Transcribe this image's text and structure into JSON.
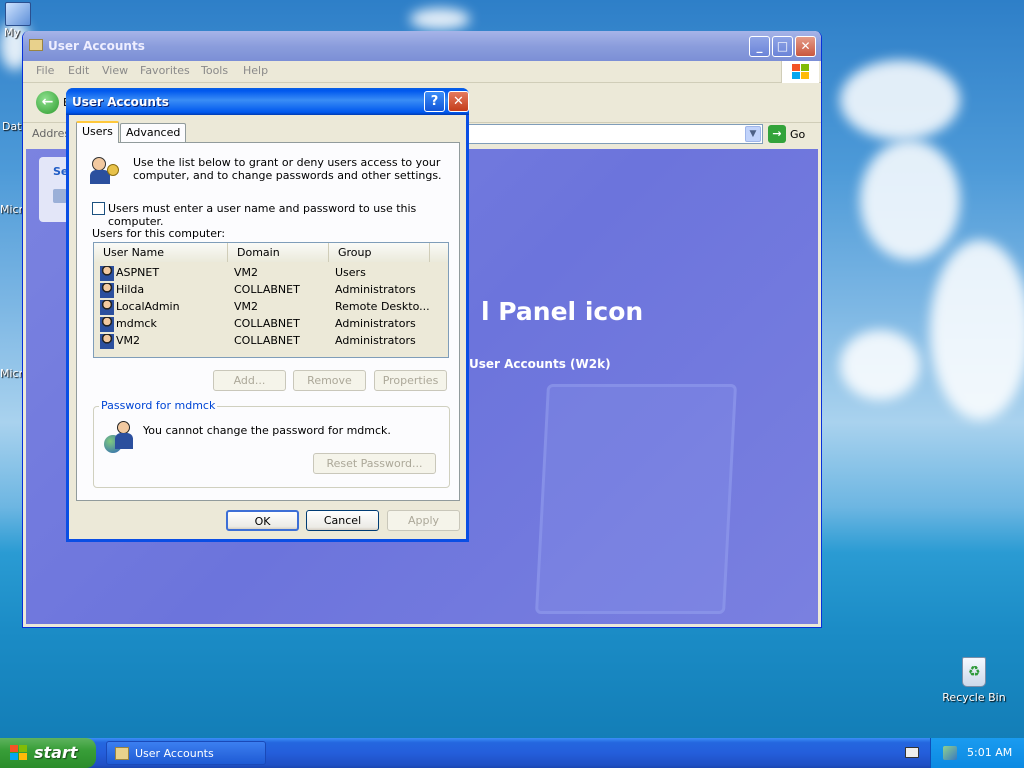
{
  "desktop": {
    "icons": [
      {
        "label": "My"
      },
      {
        "label": "Dat"
      },
      {
        "label": "Micro"
      },
      {
        "label": "Micro"
      },
      {
        "label": "Recycle Bin"
      }
    ]
  },
  "explorer": {
    "title": "User Accounts",
    "menu": [
      "File",
      "Edit",
      "View",
      "Favorites",
      "Tools",
      "Help"
    ],
    "back_label": "B",
    "address_label": "Addres",
    "go_label": "Go",
    "left_panel_label": "Se",
    "heading": "l Panel icon",
    "subheading": "User Accounts (W2k)"
  },
  "dialog": {
    "title": "User Accounts",
    "tabs": [
      "Users",
      "Advanced"
    ],
    "intro_line1": "Use the list below to grant or deny users access to your",
    "intro_line2": "computer, and to change passwords and other settings.",
    "require_login_label": "Users must enter a user name and password to use this computer.",
    "require_login_checked": false,
    "users_label": "Users for this computer:",
    "columns": [
      "User Name",
      "Domain",
      "Group"
    ],
    "users": [
      {
        "name": "ASPNET",
        "domain": "VM2",
        "group": "Users"
      },
      {
        "name": "Hilda",
        "domain": "COLLABNET",
        "group": "Administrators"
      },
      {
        "name": "LocalAdmin",
        "domain": "VM2",
        "group": "Remote Deskto..."
      },
      {
        "name": "mdmck",
        "domain": "COLLABNET",
        "group": "Administrators"
      },
      {
        "name": "VM2",
        "domain": "COLLABNET",
        "group": "Administrators"
      }
    ],
    "add_label": "Add...",
    "remove_label": "Remove",
    "properties_label": "Properties",
    "password_group_label": "Password for mdmck",
    "password_message": "You cannot change the password for mdmck.",
    "reset_password_label": "Reset Password...",
    "ok_label": "OK",
    "cancel_label": "Cancel",
    "apply_label": "Apply"
  },
  "taskbar": {
    "start_label": "start",
    "task_label": "User Accounts",
    "clock": "5:01 AM"
  }
}
